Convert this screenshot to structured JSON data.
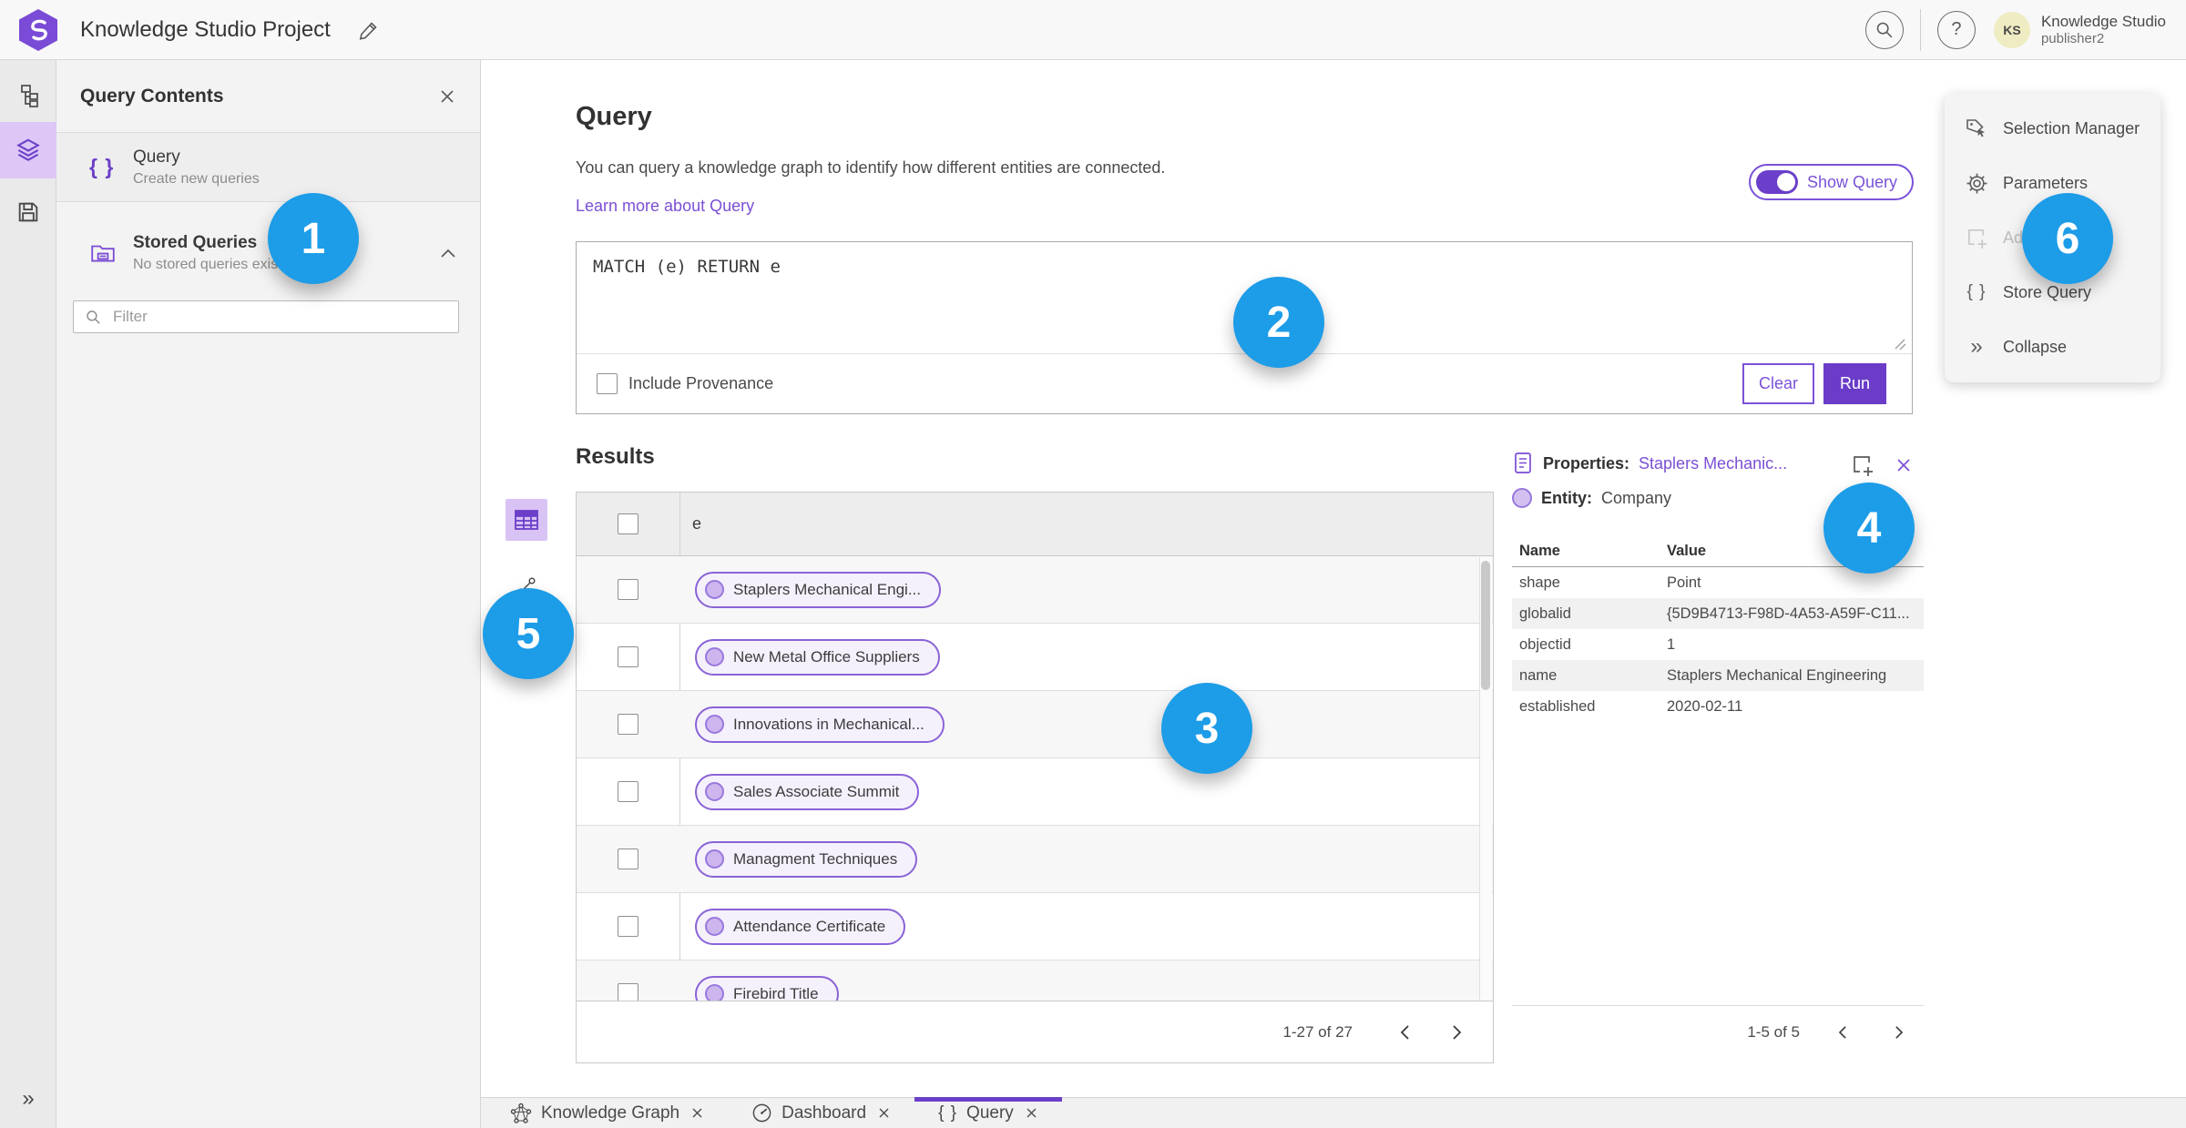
{
  "header": {
    "title": "Knowledge Studio Project",
    "user_name": "Knowledge Studio",
    "user_role": "publisher2",
    "avatar_initials": "KS",
    "help_glyph": "?"
  },
  "contents_panel": {
    "title": "Query Contents",
    "query_item": {
      "title": "Query",
      "subtitle": "Create new queries"
    },
    "stored_queries": {
      "title": "Stored Queries",
      "subtitle": "No stored queries exist"
    },
    "filter_placeholder": "Filter"
  },
  "query_section": {
    "title": "Query",
    "description": "You can query a knowledge graph to identify how different entities are connected.",
    "learn_more": "Learn more about Query",
    "show_query_label": "Show Query",
    "query_text": "MATCH (e) RETURN e",
    "include_provenance_label": "Include Provenance",
    "clear_label": "Clear",
    "run_label": "Run"
  },
  "results": {
    "title": "Results",
    "column_header": "e",
    "rows": [
      {
        "label": "Staplers Mechanical Engi..."
      },
      {
        "label": "New Metal Office Suppliers"
      },
      {
        "label": "Innovations in Mechanical..."
      },
      {
        "label": "Sales Associate Summit"
      },
      {
        "label": "Managment Techniques"
      },
      {
        "label": "Attendance Certificate"
      },
      {
        "label": "Firebird Title"
      }
    ],
    "pagination": "1-27 of 27"
  },
  "properties": {
    "label": "Properties:",
    "link": "Staplers Mechanic...",
    "entity_label": "Entity:",
    "entity_value": "Company",
    "columns": {
      "name": "Name",
      "value": "Value"
    },
    "rows": [
      {
        "name": "shape",
        "value": "Point"
      },
      {
        "name": "globalid",
        "value": "{5D9B4713-F98D-4A53-A59F-C11..."
      },
      {
        "name": "objectid",
        "value": "1"
      },
      {
        "name": "name",
        "value": "Staplers Mechanical Engineering"
      },
      {
        "name": "established",
        "value": "2020-02-11"
      }
    ],
    "pagination": "1-5 of 5"
  },
  "context_menu": {
    "items": [
      {
        "label": "Selection Manager"
      },
      {
        "label": "Parameters"
      },
      {
        "label": "Add"
      },
      {
        "label": "Store Query"
      },
      {
        "label": "Collapse"
      }
    ]
  },
  "tabs": [
    {
      "label": "Knowledge Graph"
    },
    {
      "label": "Dashboard"
    },
    {
      "label": "Query"
    }
  ],
  "annotations": {
    "labels": [
      "1",
      "2",
      "3",
      "4",
      "5",
      "6"
    ]
  },
  "icons_text": {
    "braces": "{ }",
    "collapse_chevrons": "»",
    "expand_chevrons": "»"
  },
  "colors": {
    "accent_purple": "#6a3cc8",
    "link_purple": "#7b4fd4",
    "selection_lavender": "#dcc7f6",
    "annotation_blue": "#1d9ce8"
  }
}
